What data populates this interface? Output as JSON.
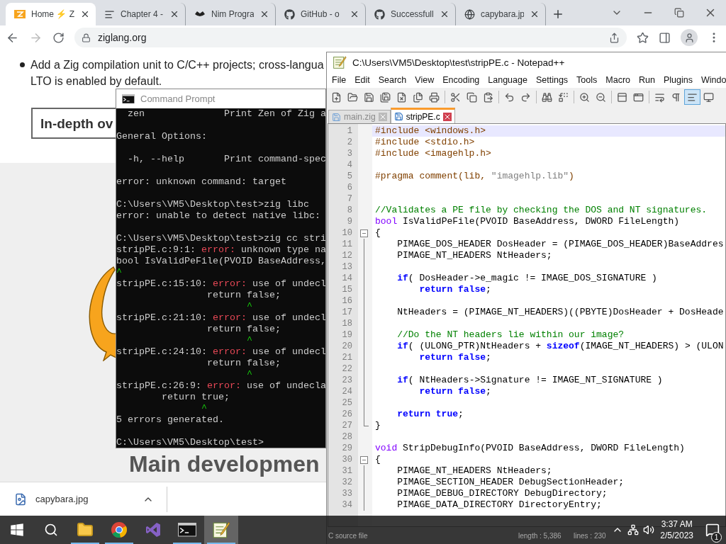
{
  "browser": {
    "tabs": [
      {
        "title": "Home ⚡ Z",
        "selected": true
      },
      {
        "title": "Chapter 4 -",
        "selected": false
      },
      {
        "title": "Nim Progra",
        "selected": false
      },
      {
        "title": "GitHub - o",
        "selected": false
      },
      {
        "title": "Successfull",
        "selected": false
      },
      {
        "title": "capybara.jp",
        "selected": false
      }
    ],
    "nav": {
      "back_disabled": false,
      "forward_disabled": true
    },
    "address": "ziglang.org",
    "page": {
      "bullet_lines": [
        "Add a Zig compilation unit to C/C++ projects; cross-langua",
        "LTO is enabled by default."
      ],
      "section_button": "In-depth ov",
      "heading": "Main developmen"
    },
    "downloads": [
      {
        "file": "capybara.jpg"
      }
    ]
  },
  "cmd": {
    "title": "Command Prompt",
    "blocks": [
      [
        [
          {
            "kind": "plain",
            "text": "  zen              Print Zen of Zig a"
          }
        ]
      ],
      [
        [
          {
            "kind": "plain",
            "text": "General Options:"
          }
        ]
      ],
      [
        [
          {
            "kind": "plain",
            "text": "  -h, --help       Print command-spec"
          }
        ]
      ],
      [
        [
          {
            "kind": "plain",
            "text": "error: unknown command: target"
          }
        ]
      ],
      [
        [
          {
            "kind": "plain",
            "text": "C:\\Users\\VM5\\Desktop\\test>zig libc"
          }
        ],
        [
          {
            "kind": "plain",
            "text": "error: unable to detect native libc:"
          }
        ]
      ],
      [
        [
          {
            "kind": "plain",
            "text": "C:\\Users\\VM5\\Desktop\\test>zig cc stri"
          }
        ],
        [
          {
            "kind": "plain",
            "text": "stripPE.c:9:1: "
          },
          {
            "kind": "error",
            "text": "error:"
          },
          {
            "kind": "plain",
            "text": " unknown type na"
          }
        ],
        [
          {
            "kind": "plain",
            "text": "bool IsValidPeFile(PVOID BaseAddress,"
          }
        ],
        [
          {
            "kind": "caret",
            "text": "^"
          }
        ],
        [
          {
            "kind": "plain",
            "text": "stripPE.c:15:10: "
          },
          {
            "kind": "error",
            "text": "error:"
          },
          {
            "kind": "plain",
            "text": " use of undecl"
          }
        ],
        [
          {
            "kind": "plain",
            "text": "                return false;"
          }
        ],
        [
          {
            "kind": "caret",
            "text": "                       ^"
          }
        ],
        [
          {
            "kind": "plain",
            "text": "stripPE.c:21:10: "
          },
          {
            "kind": "error",
            "text": "error:"
          },
          {
            "kind": "plain",
            "text": " use of undecl"
          }
        ],
        [
          {
            "kind": "plain",
            "text": "                return false;"
          }
        ],
        [
          {
            "kind": "caret",
            "text": "                       ^"
          }
        ],
        [
          {
            "kind": "plain",
            "text": "stripPE.c:24:10: "
          },
          {
            "kind": "error",
            "text": "error:"
          },
          {
            "kind": "plain",
            "text": " use of undecl"
          }
        ],
        [
          {
            "kind": "plain",
            "text": "                return false;"
          }
        ],
        [
          {
            "kind": "caret",
            "text": "                       ^"
          }
        ],
        [
          {
            "kind": "plain",
            "text": "stripPE.c:26:9: "
          },
          {
            "kind": "error",
            "text": "error:"
          },
          {
            "kind": "plain",
            "text": " use of undecla"
          }
        ],
        [
          {
            "kind": "plain",
            "text": "        return true;"
          }
        ],
        [
          {
            "kind": "caret",
            "text": "               ^"
          }
        ],
        [
          {
            "kind": "plain",
            "text": "5 errors generated."
          }
        ]
      ],
      [
        [
          {
            "kind": "plain",
            "text": "C:\\Users\\VM5\\Desktop\\test>"
          }
        ]
      ]
    ]
  },
  "npp": {
    "title": "C:\\Users\\VM5\\Desktop\\test\\stripPE.c - Notepad++",
    "menu": [
      "File",
      "Edit",
      "Search",
      "View",
      "Encoding",
      "Language",
      "Settings",
      "Tools",
      "Macro",
      "Run",
      "Plugins",
      "Windo"
    ],
    "toolbar": [
      {
        "selected": false
      },
      {
        "selected": false
      },
      {
        "selected": false
      },
      {
        "selected": false
      },
      {
        "selected": false
      },
      {
        "selected": false
      },
      {
        "selected": false
      },
      {
        "selected": false
      },
      {
        "selected": false
      },
      {
        "selected": false
      },
      {
        "selected": false
      },
      {
        "selected": false
      },
      {
        "selected": false
      },
      {
        "selected": false
      },
      {
        "selected": false
      },
      {
        "selected": false
      },
      {
        "selected": false
      },
      {
        "selected": false
      },
      {
        "selected": false
      },
      {
        "selected": false
      },
      {
        "selected": true
      },
      {
        "selected": false
      }
    ],
    "tabs": [
      {
        "label": "main.zig",
        "selected": false
      },
      {
        "label": "stripPE.c",
        "selected": true
      }
    ],
    "lines": [
      {
        "number": "1",
        "current": true,
        "kind": "plain",
        "tokens": [
          {
            "kind": "pre",
            "text": "#include <windows.h>"
          }
        ]
      },
      {
        "number": "2",
        "current": false,
        "kind": "plain",
        "tokens": [
          {
            "kind": "pre",
            "text": "#include <stdio.h>"
          }
        ]
      },
      {
        "number": "3",
        "current": false,
        "kind": "plain",
        "tokens": [
          {
            "kind": "pre",
            "text": "#include <imagehlp.h>"
          }
        ]
      },
      {
        "number": "4",
        "current": false,
        "kind": "plain"
      },
      {
        "number": "5",
        "current": false,
        "kind": "plain",
        "tokens": [
          {
            "kind": "pre",
            "text": "#pragma comment(lib, "
          },
          {
            "kind": "str",
            "text": "\"imagehlp.lib\""
          },
          {
            "kind": "pre",
            "text": ")"
          }
        ]
      },
      {
        "number": "6",
        "current": false,
        "kind": "plain"
      },
      {
        "number": "7",
        "current": false,
        "kind": "plain"
      },
      {
        "number": "8",
        "current": false,
        "kind": "plain",
        "tokens": [
          {
            "kind": "com",
            "text": "//Validates a PE file by checking the DOS and NT signatures."
          }
        ]
      },
      {
        "number": "9",
        "current": false,
        "kind": "plain",
        "tokens": [
          {
            "kind": "type",
            "text": "bool"
          },
          {
            "kind": "txt",
            "text": " IsValidPeFile(PVOID BaseAddress, DWORD FileLength)"
          }
        ]
      },
      {
        "number": "10",
        "current": false,
        "kind": "fold_start",
        "tokens": [
          {
            "kind": "txt",
            "text": "{"
          }
        ]
      },
      {
        "number": "11",
        "current": false,
        "kind": "fold_body",
        "tokens": [
          {
            "kind": "txt",
            "text": "    PIMAGE_DOS_HEADER DosHeader = (PIMAGE_DOS_HEADER)BaseAddres"
          }
        ]
      },
      {
        "number": "12",
        "current": false,
        "kind": "fold_body",
        "tokens": [
          {
            "kind": "txt",
            "text": "    PIMAGE_NT_HEADERS NtHeaders;"
          }
        ]
      },
      {
        "number": "13",
        "current": false,
        "kind": "fold_body"
      },
      {
        "number": "14",
        "current": false,
        "kind": "fold_body",
        "tokens": [
          {
            "kind": "kw",
            "text": "    if"
          },
          {
            "kind": "txt",
            "text": "( DosHeader->e_magic != IMAGE_DOS_SIGNATURE )"
          }
        ]
      },
      {
        "number": "15",
        "current": false,
        "kind": "fold_body",
        "tokens": [
          {
            "kind": "kw",
            "text": "        return false"
          },
          {
            "kind": "txt",
            "text": ";"
          }
        ]
      },
      {
        "number": "16",
        "current": false,
        "kind": "fold_body"
      },
      {
        "number": "17",
        "current": false,
        "kind": "fold_body",
        "tokens": [
          {
            "kind": "txt",
            "text": "    NtHeaders = (PIMAGE_NT_HEADERS)((PBYTE)DosHeader + DosHeade"
          }
        ]
      },
      {
        "number": "18",
        "current": false,
        "kind": "fold_body"
      },
      {
        "number": "19",
        "current": false,
        "kind": "fold_body",
        "tokens": [
          {
            "kind": "com",
            "text": "    //Do the NT headers lie within our image?"
          }
        ]
      },
      {
        "number": "20",
        "current": false,
        "kind": "fold_body",
        "tokens": [
          {
            "kind": "kw",
            "text": "    if"
          },
          {
            "kind": "txt",
            "text": "( (ULONG_PTR)NtHeaders + "
          },
          {
            "kind": "kw",
            "text": "sizeof"
          },
          {
            "kind": "txt",
            "text": "(IMAGE_NT_HEADERS) > (ULON"
          }
        ]
      },
      {
        "number": "21",
        "current": false,
        "kind": "fold_body",
        "tokens": [
          {
            "kind": "kw",
            "text": "        return false"
          },
          {
            "kind": "txt",
            "text": ";"
          }
        ]
      },
      {
        "number": "22",
        "current": false,
        "kind": "fold_body"
      },
      {
        "number": "23",
        "current": false,
        "kind": "fold_body",
        "tokens": [
          {
            "kind": "kw",
            "text": "    if"
          },
          {
            "kind": "txt",
            "text": "( NtHeaders->Signature != IMAGE_NT_SIGNATURE )"
          }
        ]
      },
      {
        "number": "24",
        "current": false,
        "kind": "fold_body",
        "tokens": [
          {
            "kind": "kw",
            "text": "        return false"
          },
          {
            "kind": "txt",
            "text": ";"
          }
        ]
      },
      {
        "number": "25",
        "current": false,
        "kind": "fold_body"
      },
      {
        "number": "26",
        "current": false,
        "kind": "fold_body",
        "tokens": [
          {
            "kind": "kw",
            "text": "    return true"
          },
          {
            "kind": "txt",
            "text": ";"
          }
        ]
      },
      {
        "number": "27",
        "current": false,
        "kind": "fold_end",
        "tokens": [
          {
            "kind": "txt",
            "text": "}"
          }
        ]
      },
      {
        "number": "28",
        "current": false,
        "kind": "plain"
      },
      {
        "number": "29",
        "current": false,
        "kind": "plain",
        "tokens": [
          {
            "kind": "type",
            "text": "void"
          },
          {
            "kind": "txt",
            "text": " StripDebugInfo(PVOID BaseAddress, DWORD FileLength)"
          }
        ]
      },
      {
        "number": "30",
        "current": false,
        "kind": "fold_start",
        "tokens": [
          {
            "kind": "txt",
            "text": "{"
          }
        ]
      },
      {
        "number": "31",
        "current": false,
        "kind": "fold_body",
        "tokens": [
          {
            "kind": "txt",
            "text": "    PIMAGE_NT_HEADERS NtHeaders;"
          }
        ]
      },
      {
        "number": "32",
        "current": false,
        "kind": "fold_body",
        "tokens": [
          {
            "kind": "txt",
            "text": "    PIMAGE_SECTION_HEADER DebugSectionHeader;"
          }
        ]
      },
      {
        "number": "33",
        "current": false,
        "kind": "fold_body",
        "tokens": [
          {
            "kind": "txt",
            "text": "    PIMAGE_DEBUG_DIRECTORY DebugDirectory;"
          }
        ]
      },
      {
        "number": "34",
        "current": false,
        "kind": "fold_body",
        "tokens": [
          {
            "kind": "txt",
            "text": "    PIMAGE_DATA_DIRECTORY DirectoryEntry;"
          }
        ]
      }
    ],
    "status": [
      "C source file",
      "length : 5,386",
      "lines : 230"
    ]
  },
  "taskbar": {
    "apps": [
      {
        "running": true,
        "active": false
      },
      {
        "running": true,
        "active": false
      },
      {
        "running": false,
        "active": false
      },
      {
        "running": true,
        "active": false
      },
      {
        "running": true,
        "active": true
      }
    ],
    "time": "3:37 AM",
    "date": "2/5/2023",
    "notifications": "1"
  }
}
